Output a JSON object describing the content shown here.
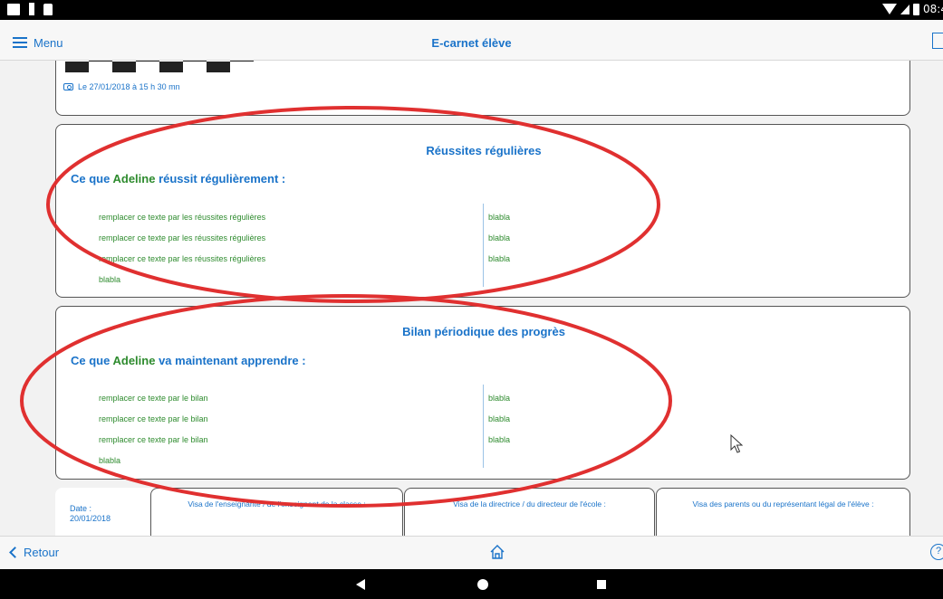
{
  "status_bar": {
    "time": "08:4"
  },
  "app_bar": {
    "menu_label": "Menu",
    "title": "E-carnet élève"
  },
  "photo_card": {
    "caption": "Le 27/01/2018 à 15 h 30 mn"
  },
  "section_reussites": {
    "title": "Réussites régulières",
    "subtitle_prefix": "Ce que ",
    "student_name": "Adeline",
    "subtitle_suffix": " réussit régulièrement :",
    "left_items": [
      "remplacer ce texte par les réussites régulières",
      "remplacer ce texte par les réussites régulières",
      "remplacer ce texte par les réussites régulières",
      "blabla"
    ],
    "right_items": [
      "blabla",
      "blabla",
      "blabla"
    ]
  },
  "section_bilan": {
    "title": "Bilan périodique des progrès",
    "subtitle_prefix": "Ce que ",
    "student_name": "Adeline",
    "subtitle_suffix": " va maintenant apprendre :",
    "left_items": [
      "remplacer ce texte par le bilan",
      "remplacer ce texte par le bilan",
      "remplacer ce texte par le bilan",
      "blabla"
    ],
    "right_items": [
      "blabla",
      "blabla",
      "blabla"
    ]
  },
  "visa": {
    "date_label": "Date :",
    "date_value": "20/01/2018",
    "teacher": "Visa de l'enseignante / de l'enseignant de la classe :",
    "director": "Visa de la directrice / du directeur de l'école :",
    "parents": "Visa des parents ou du représentant légal de l'élève :"
  },
  "bottom_bar": {
    "back_label": "Retour",
    "help_label": "?"
  },
  "colors": {
    "accent": "#1a73c9",
    "green": "#2e8b2e",
    "annotation": "#e03030"
  }
}
